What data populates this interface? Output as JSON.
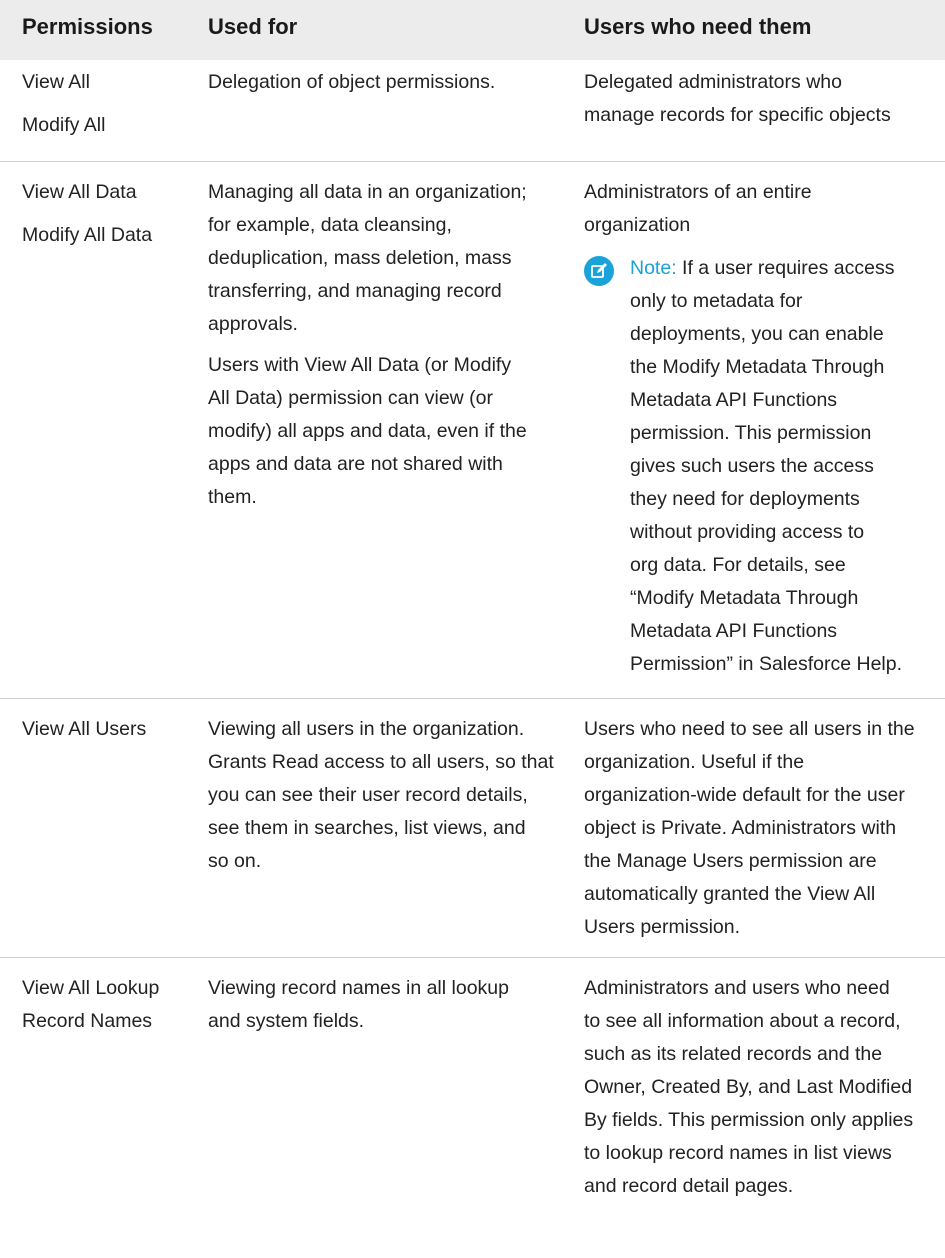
{
  "headers": {
    "permissions": "Permissions",
    "used_for": "Used for",
    "users": "Users who need them"
  },
  "rows": [
    {
      "permissions": [
        "View All",
        "Modify All"
      ],
      "used_for": [
        "Delegation of object permissions."
      ],
      "users": [
        "Delegated administrators who",
        "manage records for specific objects"
      ]
    },
    {
      "permissions": [
        "View All Data",
        "Modify All Data"
      ],
      "used_for": [
        "Managing all data in an organization;",
        "for example, data cleansing,",
        "deduplication, mass deletion, mass",
        "transferring, and managing record",
        "approvals."
      ],
      "used_for_2": [
        "Users with View All Data (or Modify",
        "All Data) permission can view (or",
        "modify) all apps and data, even if the",
        "apps and data are not shared with",
        "them."
      ],
      "users": [
        "Administrators of an entire",
        "organization"
      ],
      "note": {
        "label": "Note:",
        "icon": "edit-note-icon",
        "lines": [
          "If a user requires access",
          "only to metadata for",
          "deployments, you can enable",
          "the Modify Metadata Through",
          "Metadata API Functions",
          "permission. This permission",
          "gives such users the access",
          "they need for deployments",
          "without providing access to",
          "org data. For details, see",
          "“Modify Metadata Through",
          "Metadata API Functions",
          "Permission” in Salesforce Help."
        ]
      }
    },
    {
      "permissions": [
        "View All Users"
      ],
      "used_for": [
        "Viewing all users in the organization.",
        "Grants Read access to all users, so that",
        "you can see their user record details,",
        "see them in searches, list views, and",
        "so on."
      ],
      "users": [
        "Users who need to see all users in the",
        "organization. Useful if the",
        "organization-wide default for the user",
        "object is Private. Administrators with",
        "the Manage Users permission are",
        "automatically granted the View All",
        "Users permission."
      ]
    },
    {
      "permissions": [
        "View All Lookup",
        "Record Names"
      ],
      "used_for": [
        "Viewing record names in all lookup",
        "and system fields."
      ],
      "users": [
        "Administrators and users who need",
        "to see all information about a record,",
        "such as its related records and the",
        "Owner, Created By, and Last Modified",
        "By fields. This permission only applies",
        "to lookup record names in list views",
        "and record detail pages."
      ]
    }
  ],
  "colors": {
    "header_bg": "#ececec",
    "note_accent": "#1ba0d6",
    "divider": "#cfcfcf"
  }
}
